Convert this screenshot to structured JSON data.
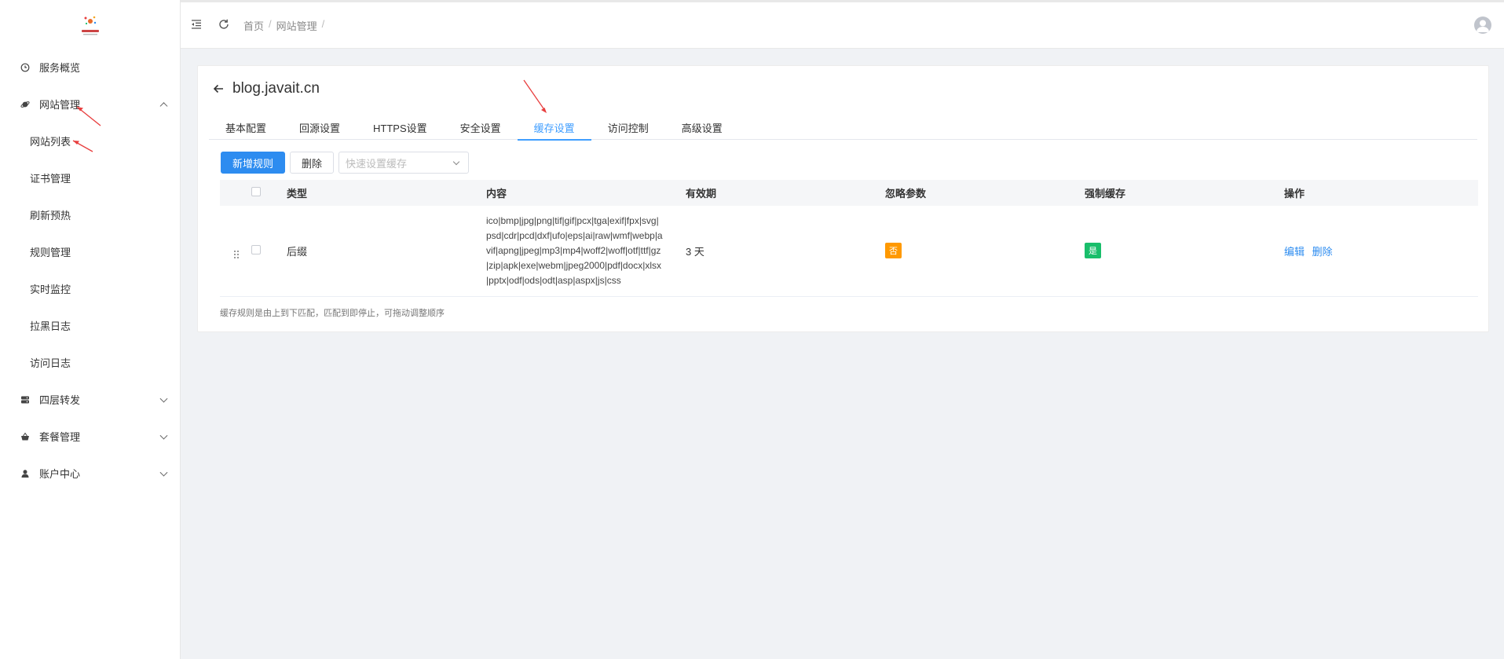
{
  "sidebar": {
    "items": [
      {
        "label": "服务概览",
        "icon": "clock-icon"
      },
      {
        "label": "网站管理",
        "icon": "planet-icon",
        "expanded": true,
        "children": [
          "网站列表",
          "证书管理",
          "刷新预热",
          "规则管理",
          "实时监控",
          "拉黑日志",
          "访问日志"
        ]
      },
      {
        "label": "四层转发",
        "icon": "server-icon"
      },
      {
        "label": "套餐管理",
        "icon": "basket-icon"
      },
      {
        "label": "账户中心",
        "icon": "user-icon"
      }
    ]
  },
  "header": {
    "breadcrumbs": [
      "首页",
      "网站管理"
    ],
    "sep": "/"
  },
  "page": {
    "title": "blog.javait.cn",
    "tabs": [
      "基本配置",
      "回源设置",
      "HTTPS设置",
      "安全设置",
      "缓存设置",
      "访问控制",
      "高级设置"
    ],
    "active_tab": "缓存设置"
  },
  "toolbar": {
    "add_label": "新增规则",
    "delete_label": "删除",
    "quick_select_placeholder": "快速设置缓存"
  },
  "table": {
    "columns": [
      "类型",
      "内容",
      "有效期",
      "忽略参数",
      "强制缓存",
      "操作"
    ],
    "rows": [
      {
        "type": "后缀",
        "content": "ico|bmp|jpg|png|tif|gif|pcx|tga|exif|fpx|svg|psd|cdr|pcd|dxf|ufo|eps|ai|raw|wmf|webp|avif|apng|jpeg|mp3|mp4|woff2|woff|otf|ttf|gz|zip|apk|exe|webm|jpeg2000|pdf|docx|xlsx|pptx|odf|ods|odt|asp|aspx|js|css",
        "validity": "3 天",
        "ignore_params": "否",
        "force_cache": "是",
        "actions": [
          "编辑",
          "删除"
        ]
      }
    ]
  },
  "hint": "缓存规则是由上到下匹配，匹配到即停止，可拖动调整顺序",
  "colors": {
    "primary": "#2d8cf0",
    "tag_no": "#ff9900",
    "tag_yes": "#19be6b",
    "annotation_arrow": "#e83e3e"
  }
}
